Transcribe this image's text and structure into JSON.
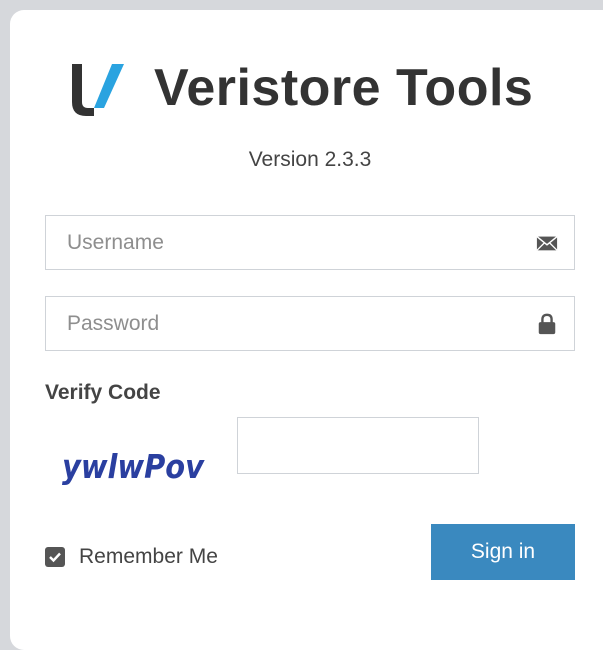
{
  "brand": {
    "logo_icon": "veristore-logo-icon",
    "title": "Veristore Tools",
    "logo_colors": {
      "dark": "#333333",
      "accent": "#2aa3e0"
    }
  },
  "version": "Version 2.3.3",
  "username": {
    "placeholder": "Username",
    "value": "",
    "icon": "envelope-icon"
  },
  "password": {
    "placeholder": "Password",
    "value": "",
    "icon": "lock-icon"
  },
  "verify": {
    "label": "Verify Code",
    "captcha_text": "ywlwPov",
    "captcha_color": "#2a3fa0",
    "code_value": ""
  },
  "remember": {
    "label": "Remember Me",
    "checked": true
  },
  "sign_in": {
    "label": "Sign in",
    "color": "#3a89bf"
  }
}
